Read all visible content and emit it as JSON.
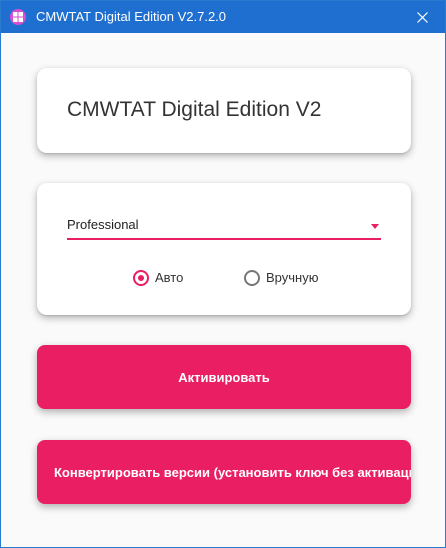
{
  "window": {
    "title": "CMWTAT Digital Edition V2.7.2.0",
    "accent_color": "#e91e63",
    "titlebar_color": "#1f6fd1",
    "app_icon": "windows-logo-icon",
    "close_icon": "close-icon"
  },
  "header": {
    "title": "CMWTAT Digital Edition V2"
  },
  "edition_select": {
    "value": "Professional",
    "icon": "dropdown-arrow-icon"
  },
  "mode": {
    "auto_label": "Авто",
    "manual_label": "Вручную",
    "selected": "auto"
  },
  "buttons": {
    "activate_label": "Активировать",
    "convert_label": "Конвертировать версии (установить ключ без активации)"
  }
}
